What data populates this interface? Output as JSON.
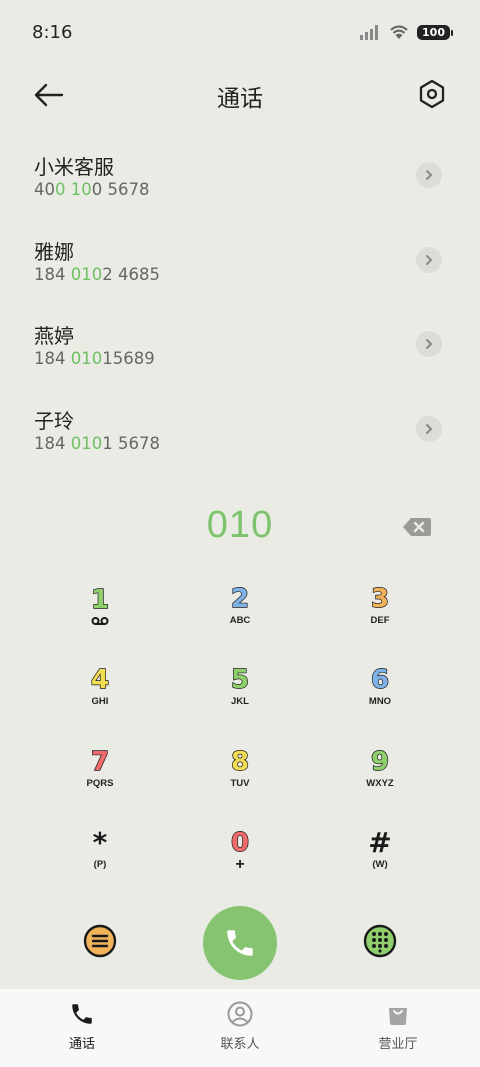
{
  "status_bar": {
    "time": "8:16",
    "battery": "100"
  },
  "header": {
    "title": "通话"
  },
  "contacts": [
    {
      "name": "小米客服",
      "num_parts": [
        "40",
        "0 10",
        "0 5678"
      ]
    },
    {
      "name": "雅娜",
      "num_parts": [
        "184 ",
        "010",
        "2 4685"
      ]
    },
    {
      "name": "燕婷",
      "num_parts": [
        "184 ",
        "010",
        "15689"
      ]
    },
    {
      "name": "子玲",
      "num_parts": [
        "184 ",
        "010",
        "1 5678"
      ]
    }
  ],
  "dial": {
    "number": "010"
  },
  "keypad": [
    {
      "digit": "1",
      "letters": "",
      "color": "#8fd06d"
    },
    {
      "digit": "2",
      "letters": "ABC",
      "color": "#7fb3e8"
    },
    {
      "digit": "3",
      "letters": "DEF",
      "color": "#f0b35a"
    },
    {
      "digit": "4",
      "letters": "GHI",
      "color": "#f2dc52"
    },
    {
      "digit": "5",
      "letters": "JKL",
      "color": "#8fd06d"
    },
    {
      "digit": "6",
      "letters": "MNO",
      "color": "#7fb3e8"
    },
    {
      "digit": "7",
      "letters": "PQRS",
      "color": "#ef6b6b"
    },
    {
      "digit": "8",
      "letters": "TUV",
      "color": "#f2dc52"
    },
    {
      "digit": "9",
      "letters": "WXYZ",
      "color": "#8fd06d"
    },
    {
      "digit": "*",
      "letters": "(P)",
      "color": "#1a1a1a"
    },
    {
      "digit": "0",
      "letters": "+",
      "color": "#ef6b6b"
    },
    {
      "digit": "#",
      "letters": "(W)",
      "color": "#1a1a1a"
    }
  ],
  "actions": {
    "left_icon": "menu-icon",
    "call_icon": "phone-icon",
    "right_icon": "dialpad-icon"
  },
  "tabs": [
    {
      "label": "通话",
      "icon": "phone-icon",
      "active": true
    },
    {
      "label": "联系人",
      "icon": "contacts-icon",
      "active": false
    },
    {
      "label": "营业厅",
      "icon": "shopping-bag-icon",
      "active": false
    }
  ],
  "colors": {
    "accent": "#7cc36c",
    "call_button": "#86c472",
    "background": "#ebebe6"
  }
}
